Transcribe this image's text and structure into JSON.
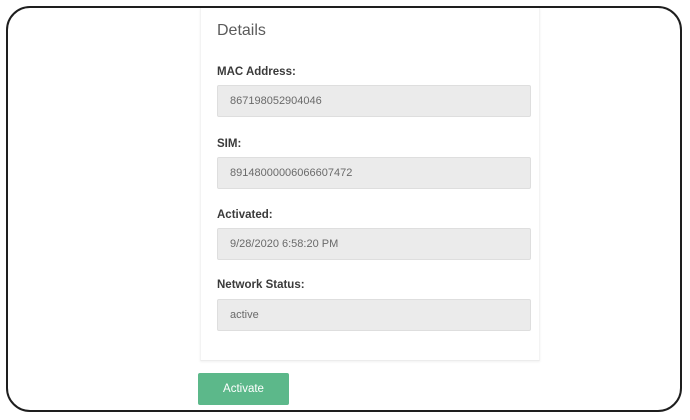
{
  "details": {
    "title": "Details",
    "fields": [
      {
        "label": "MAC Address:",
        "value": "867198052904046"
      },
      {
        "label": "SIM:",
        "value": "89148000006066607472"
      },
      {
        "label": "Activated:",
        "value": "9/28/2020 6:58:20 PM"
      },
      {
        "label": "Network Status:",
        "value": "active"
      }
    ]
  },
  "actions": {
    "activate_label": "Activate"
  },
  "colors": {
    "activate_button": "#5cb88a",
    "field_background": "#ebebeb"
  }
}
